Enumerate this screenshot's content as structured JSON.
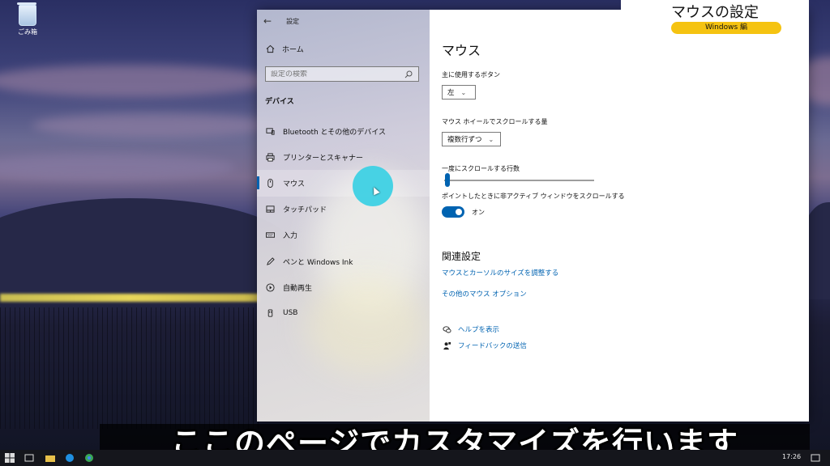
{
  "desktop": {
    "recycle_bin_label": "ごみ箱"
  },
  "window": {
    "title": "設定"
  },
  "nav": {
    "home_label": "ホーム",
    "search_placeholder": "設定の検索",
    "section_title": "デバイス",
    "items": [
      {
        "label": "Bluetooth とその他のデバイス",
        "icon": "bluetooth-devices-icon"
      },
      {
        "label": "プリンターとスキャナー",
        "icon": "printer-icon"
      },
      {
        "label": "マウス",
        "icon": "mouse-icon",
        "selected": true
      },
      {
        "label": "タッチパッド",
        "icon": "touchpad-icon"
      },
      {
        "label": "入力",
        "icon": "keyboard-icon"
      },
      {
        "label": "ペンと Windows Ink",
        "icon": "pen-icon"
      },
      {
        "label": "自動再生",
        "icon": "autoplay-icon"
      },
      {
        "label": "USB",
        "icon": "usb-icon"
      }
    ]
  },
  "content": {
    "page_title": "マウス",
    "primary_button_label": "主に使用するボタン",
    "primary_button_value": "左",
    "wheel_scroll_label": "マウス ホイールでスクロールする量",
    "wheel_scroll_value": "複数行ずつ",
    "lines_label": "一度にスクロールする行数",
    "lines_value": 0.03,
    "inactive_scroll_label": "ポイントしたときに非アクティブ ウィンドウをスクロールする",
    "inactive_scroll_state": "オン",
    "related_title": "関連設定",
    "related_links": [
      "マウスとカーソルのサイズを調整する",
      "その他のマウス オプション"
    ],
    "help_link": "ヘルプを表示",
    "feedback_link": "フィードバックの送信"
  },
  "overlay": {
    "title": "マウスの設定",
    "badge": "Windows 編",
    "caption": "ここのページでカスタマイズを行います"
  },
  "taskbar": {
    "time": "17:26"
  },
  "colors": {
    "accent": "#0063b1",
    "badge": "#f5c311",
    "halo": "#3ed1e4"
  }
}
